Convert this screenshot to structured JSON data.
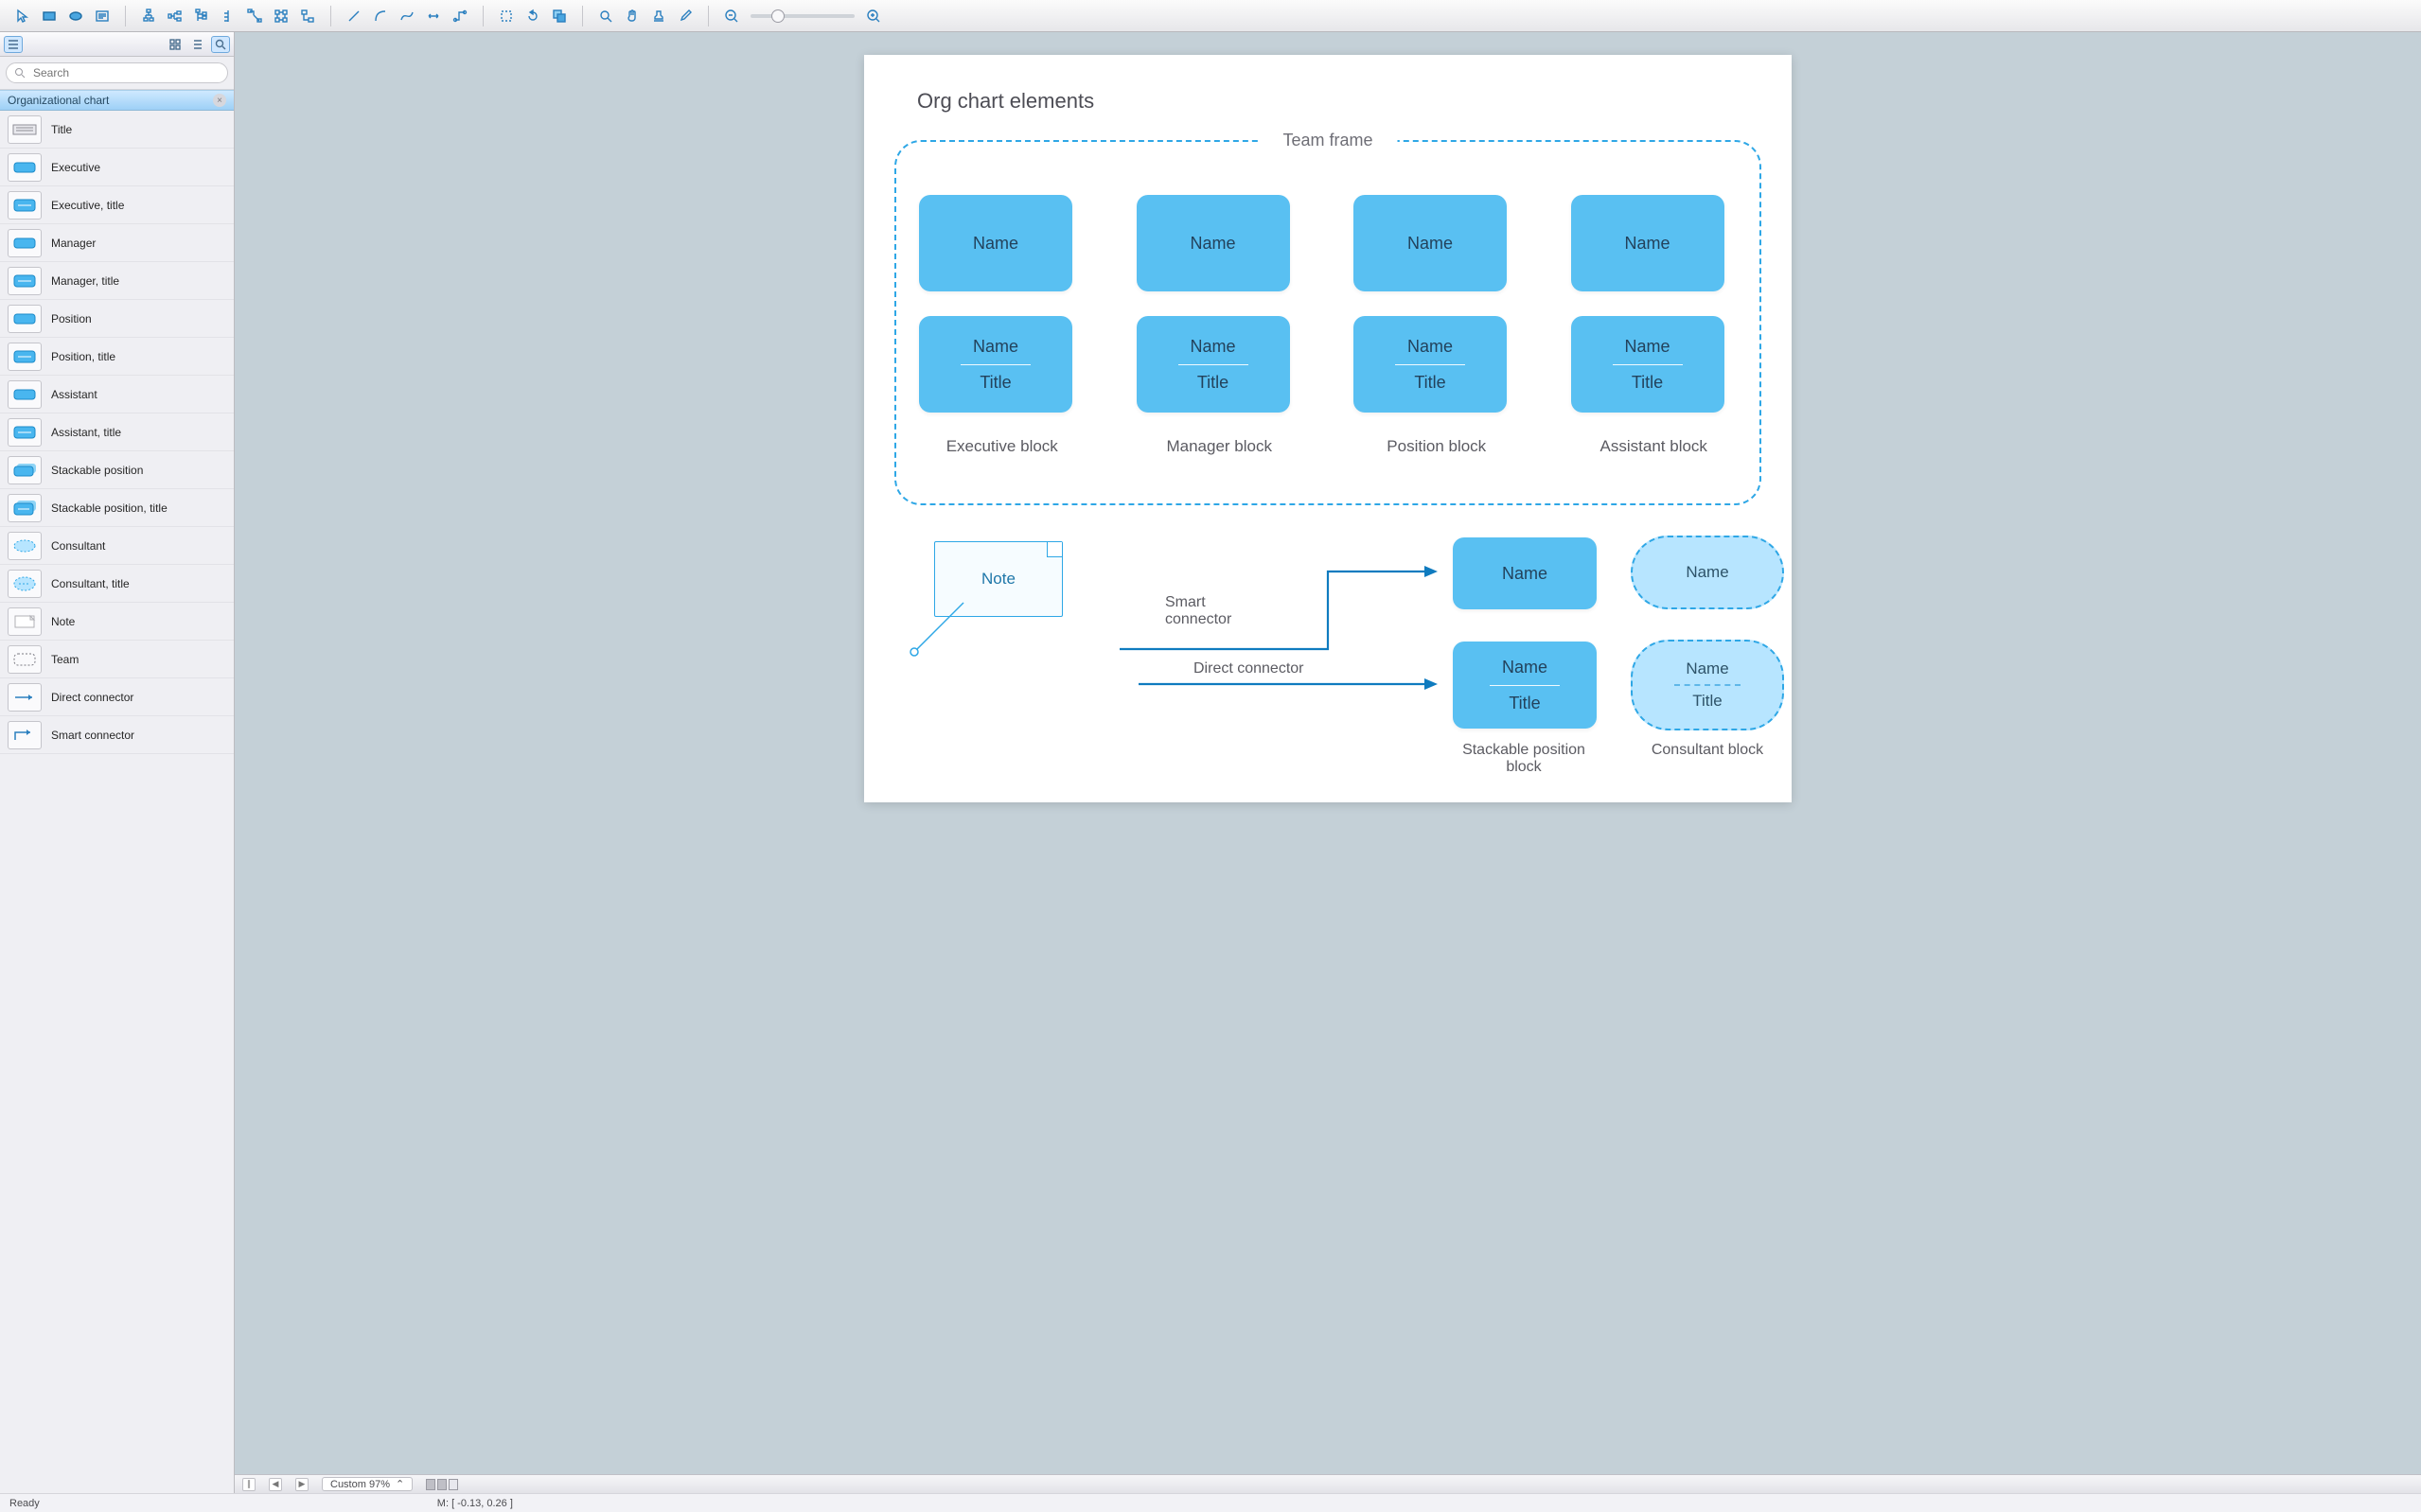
{
  "search_placeholder": "Search",
  "sidebar": {
    "panel_title": "Organizational chart",
    "items": [
      {
        "label": "Title"
      },
      {
        "label": "Executive"
      },
      {
        "label": "Executive, title"
      },
      {
        "label": "Manager"
      },
      {
        "label": "Manager, title"
      },
      {
        "label": "Position"
      },
      {
        "label": "Position, title"
      },
      {
        "label": "Assistant"
      },
      {
        "label": "Assistant, title"
      },
      {
        "label": "Stackable position"
      },
      {
        "label": "Stackable position, title"
      },
      {
        "label": "Consultant"
      },
      {
        "label": "Consultant, title"
      },
      {
        "label": "Note"
      },
      {
        "label": "Team"
      },
      {
        "label": "Direct connector"
      },
      {
        "label": "Smart connector"
      }
    ]
  },
  "page": {
    "title": "Org chart elements",
    "team_label": "Team frame",
    "row1": [
      {
        "name": "Name"
      },
      {
        "name": "Name"
      },
      {
        "name": "Name"
      },
      {
        "name": "Name"
      }
    ],
    "row2": [
      {
        "name": "Name",
        "title": "Title"
      },
      {
        "name": "Name",
        "title": "Title"
      },
      {
        "name": "Name",
        "title": "Title"
      },
      {
        "name": "Name",
        "title": "Title"
      }
    ],
    "col_labels": [
      "Executive block",
      "Manager block",
      "Position block",
      "Assistant block"
    ],
    "note_text": "Note",
    "smart_label": "Smart connector",
    "direct_label": "Direct connector",
    "stack_name": "Name",
    "stack_title": "Title",
    "stack_single_name": "Name",
    "pill_name": "Name",
    "pill2_name": "Name",
    "pill2_title": "Title",
    "under_stack": "Stackable position block",
    "under_pill": "Consultant block"
  },
  "bottom": {
    "zoom": "Custom 97%",
    "mouse": "M: [ -0.13, 0.26 ]"
  },
  "status": {
    "ready": "Ready"
  }
}
